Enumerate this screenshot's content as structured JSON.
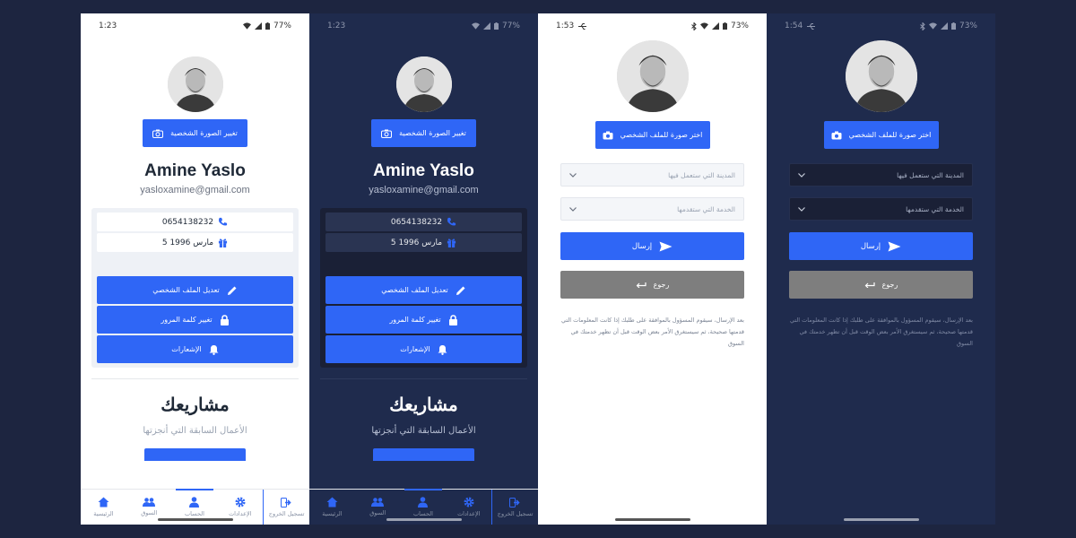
{
  "screens": [
    {
      "status_time": "1:23",
      "battery": "77%",
      "change_photo_label": "تغيير الصورة الشخصية",
      "name": "Amine Yaslo",
      "email": "yasloxamine@gmail.com",
      "phone": "0654138232",
      "birthday": "5 مارس 1996",
      "actions": [
        "تعديل الملف الشخصي",
        "تغيير كلمة المرور",
        "الإشعارات"
      ],
      "projects_title": "مشاريعك",
      "projects_subtitle": "الأعمال السابقة التي أنجزتها",
      "nav": [
        "الرئيسية",
        "السوق",
        "الحساب",
        "الإعدادات",
        "تسجيل الخروج"
      ]
    },
    {
      "status_time": "1:23",
      "battery": "77%",
      "change_photo_label": "تغيير الصورة الشخصية",
      "name": "Amine Yaslo",
      "email": "yasloxamine@gmail.com",
      "phone": "0654138232",
      "birthday": "5 مارس 1996",
      "actions": [
        "تعديل الملف الشخصي",
        "تغيير كلمة المرور",
        "الإشعارات"
      ],
      "projects_title": "مشاريعك",
      "projects_subtitle": "الأعمال السابقة التي أنجزتها",
      "nav": [
        "الرئيسية",
        "السوق",
        "الحساب",
        "الإعدادات",
        "تسجيل الخروج"
      ]
    },
    {
      "status_time": "1:53",
      "battery": "73%",
      "pick_photo_label": "اختر صورة للملف الشخصي",
      "city_placeholder": "المدينة التي ستعمل فيها",
      "service_placeholder": "الخدمة التي ستقدمها",
      "send_label": "إرسال",
      "back_label": "رجوع",
      "note": "بعد الإرسال، سيقوم المسؤول بالموافقة على طلبك إذا كانت المعلومات التي قدمتها صحيحة، ثم سيستغرق الأمر بعض الوقت قبل أن تظهر خدمتك في السوق"
    },
    {
      "status_time": "1:54",
      "battery": "73%",
      "pick_photo_label": "اختر صورة للملف الشخصي",
      "city_placeholder": "المدينة التي ستعمل فيها",
      "service_placeholder": "الخدمة التي ستقدمها",
      "send_label": "إرسال",
      "back_label": "رجوع",
      "note": "بعد الإرسال، سيقوم المسؤول بالموافقة على طلبك إذا كانت المعلومات التي قدمتها صحيحة، ثم سيستغرق الأمر بعض الوقت قبل أن تظهر خدمتك في السوق"
    }
  ],
  "colors": {
    "accent": "#2f66f6",
    "dark_bg": "#1f2b4d",
    "page_bg": "#1d2540",
    "back_button": "#7e7e7e"
  }
}
